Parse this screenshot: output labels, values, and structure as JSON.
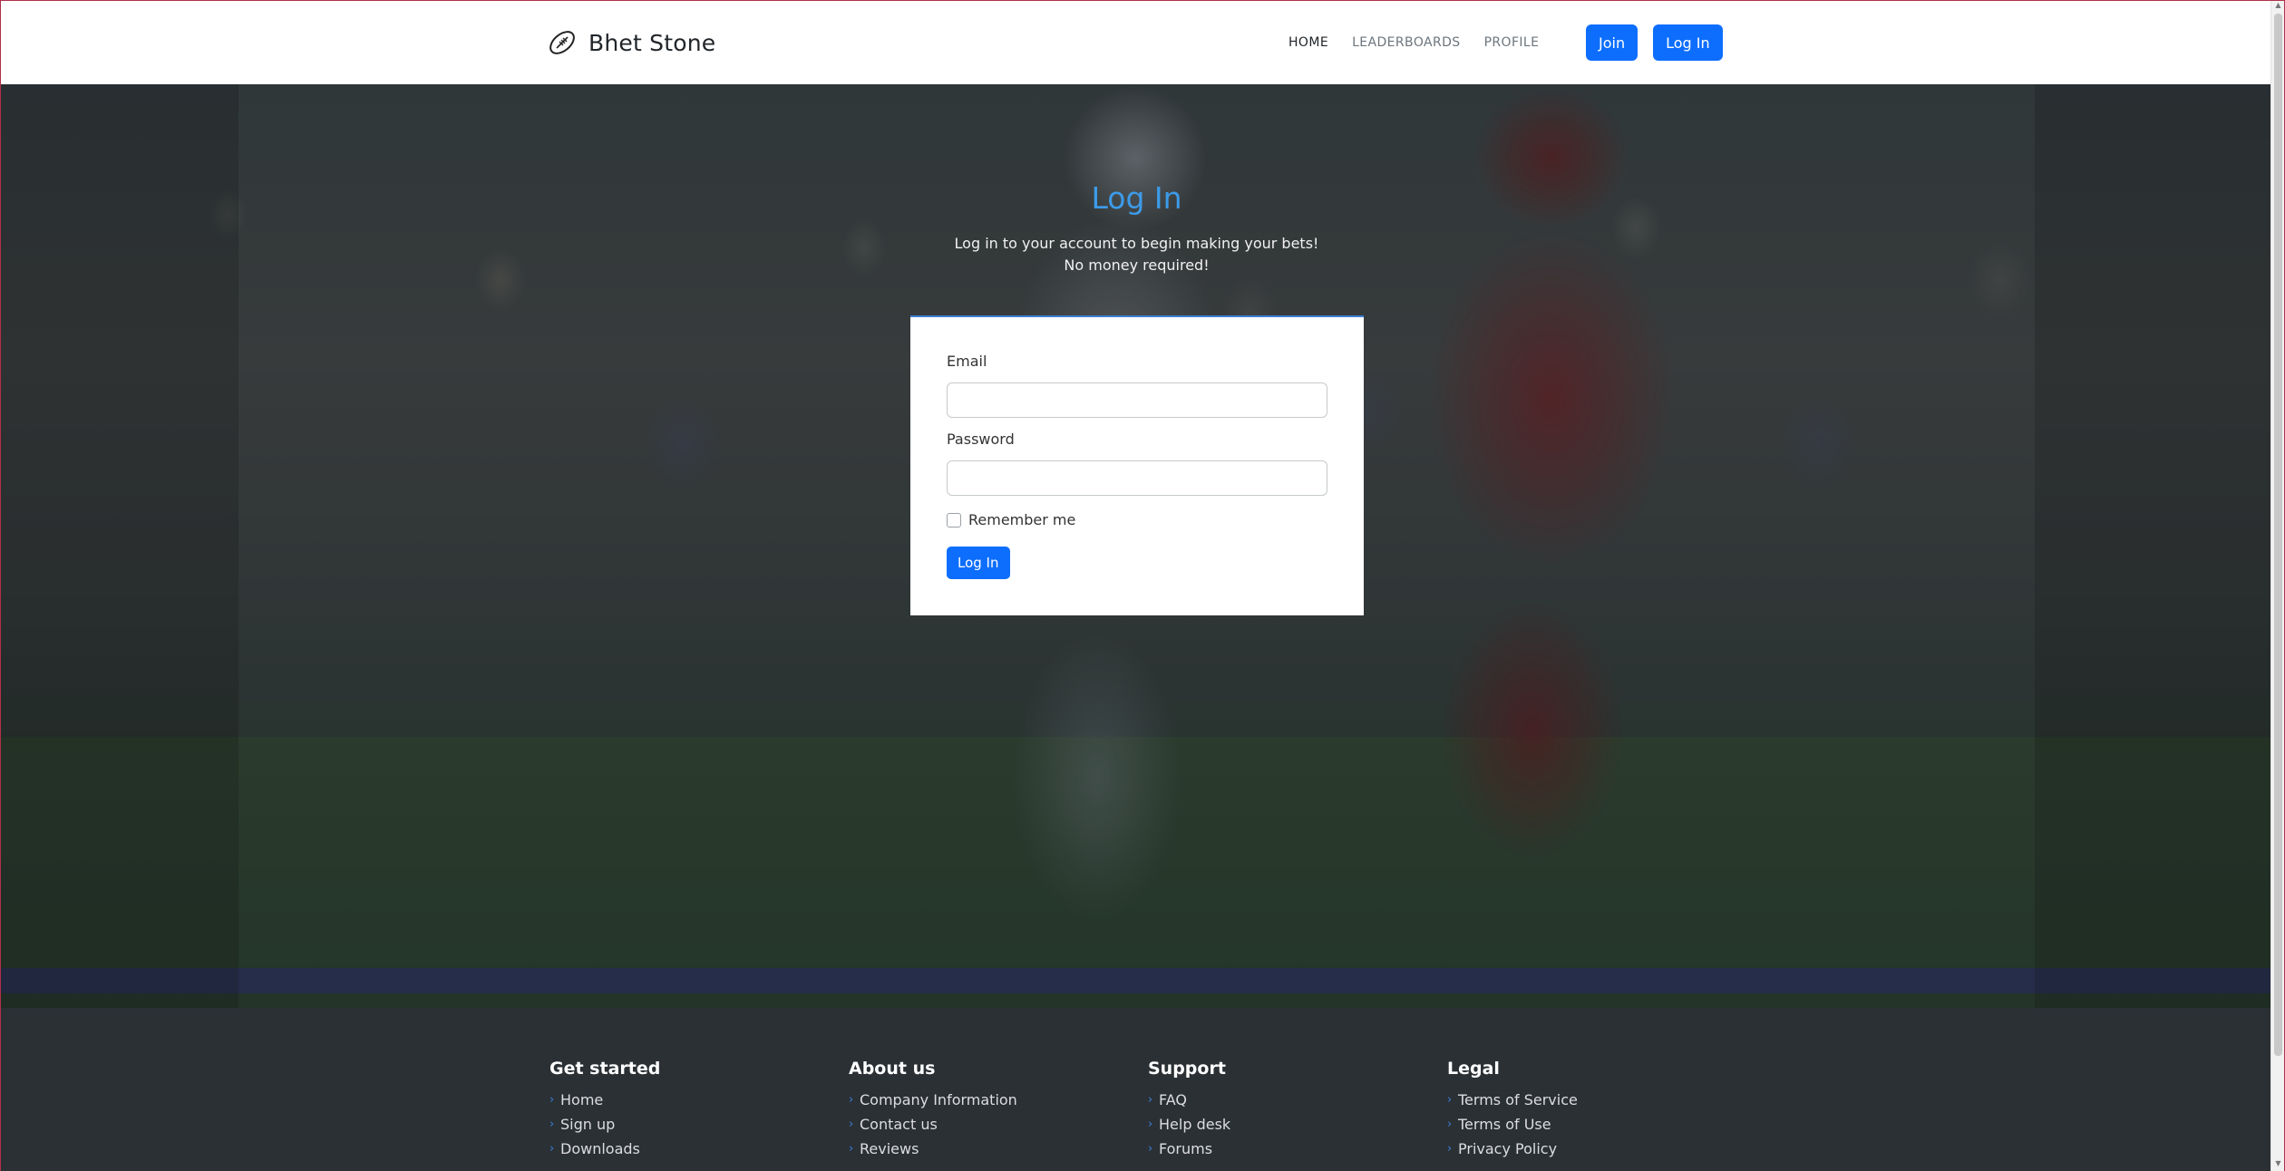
{
  "brand": {
    "name": "Bhet Stone",
    "icon": "football-icon"
  },
  "nav": {
    "links": [
      {
        "label": "HOME",
        "active": true
      },
      {
        "label": "LEADERBOARDS",
        "active": false
      },
      {
        "label": "PROFILE",
        "active": false
      }
    ],
    "join_label": "Join",
    "login_label": "Log In"
  },
  "hero": {
    "title": "Log In",
    "subtitle_line1": "Log in to your account to begin making your bets!",
    "subtitle_line2": "No money required!"
  },
  "login_form": {
    "email_label": "Email",
    "email_value": "",
    "password_label": "Password",
    "password_value": "",
    "remember_label": "Remember me",
    "remember_checked": false,
    "submit_label": "Log In"
  },
  "footer": {
    "columns": [
      {
        "heading": "Get started",
        "items": [
          "Home",
          "Sign up",
          "Downloads"
        ]
      },
      {
        "heading": "About us",
        "items": [
          "Company Information",
          "Contact us",
          "Reviews"
        ]
      },
      {
        "heading": "Support",
        "items": [
          "FAQ",
          "Help desk",
          "Forums"
        ]
      },
      {
        "heading": "Legal",
        "items": [
          "Terms of Service",
          "Terms of Use",
          "Privacy Policy"
        ]
      }
    ]
  },
  "colors": {
    "accent": "#0d6efd",
    "title_blue": "#3d9be9",
    "footer_bg": "#2b3035"
  }
}
